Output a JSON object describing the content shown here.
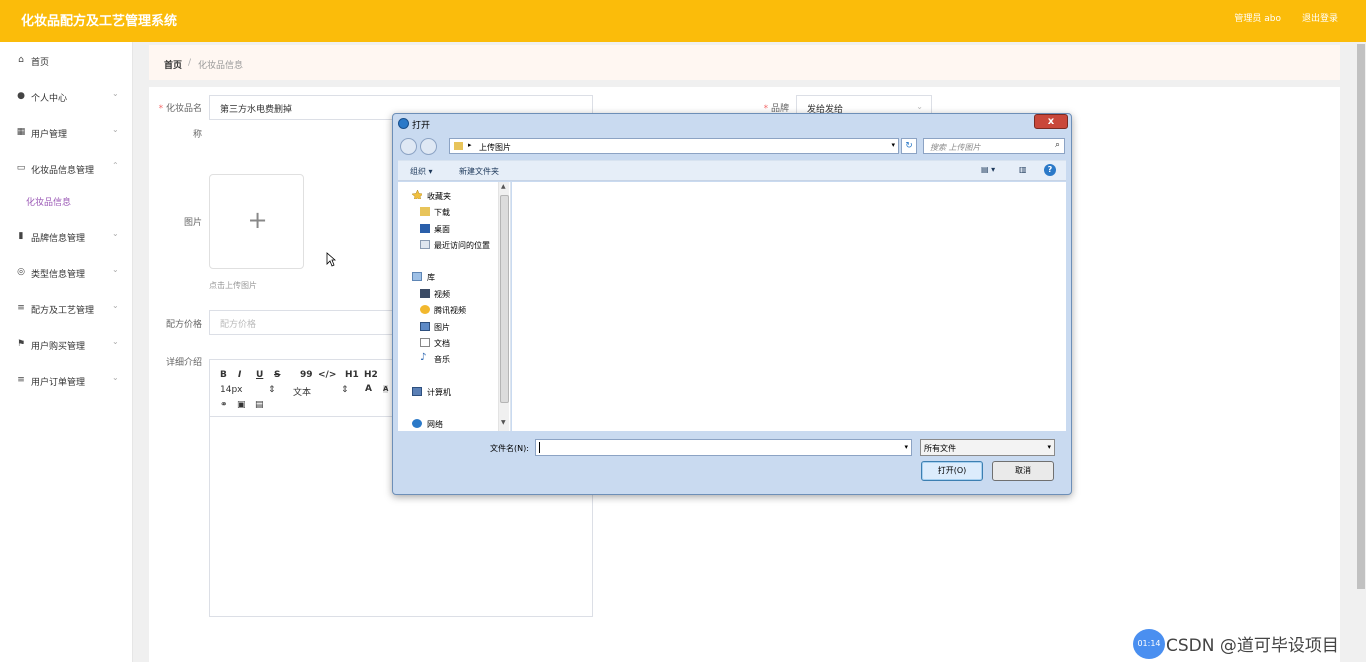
{
  "app": {
    "title": "化妆品配方及工艺管理系统",
    "admin": "管理员 abo",
    "logout": "退出登录"
  },
  "sidebar": {
    "items": [
      {
        "label": "首页",
        "icon": "home-icon",
        "expandable": false
      },
      {
        "label": "个人中心",
        "icon": "user-icon",
        "expandable": true
      },
      {
        "label": "用户管理",
        "icon": "grid-icon",
        "expandable": true
      },
      {
        "label": "化妆品信息管理",
        "icon": "card-icon",
        "expandable": true,
        "expanded": true
      },
      {
        "label": "品牌信息管理",
        "icon": "bar-chart-icon",
        "expandable": true
      },
      {
        "label": "类型信息管理",
        "icon": "target-icon",
        "expandable": true
      },
      {
        "label": "配方及工艺管理",
        "icon": "list-icon",
        "expandable": true
      },
      {
        "label": "用户购买管理",
        "icon": "flag-icon",
        "expandable": true
      },
      {
        "label": "用户订单管理",
        "icon": "list-icon",
        "expandable": true
      }
    ],
    "subitem": "化妆品信息"
  },
  "breadcrumb": {
    "home": "首页",
    "separator": "/",
    "current": "化妆品信息"
  },
  "form": {
    "name_label_1": "化妆品名",
    "name_label_2": "称",
    "name_value": "第三方水电费删掉",
    "brand_label": "品牌",
    "brand_value": "发给发给",
    "image_label": "图片",
    "upload_hint": "点击上传图片",
    "price_label": "配方价格",
    "price_placeholder": "配方价格",
    "detail_label": "详细介绍",
    "editor_toolbar": [
      "B",
      "I",
      "U",
      "S",
      "99",
      "</>",
      "H1",
      "H2"
    ],
    "font_size": "14px",
    "text_type": "文本"
  },
  "dialog": {
    "title": "打开",
    "close": "x",
    "address_path": "上传图片",
    "search_placeholder": "搜索 上传图片",
    "organize": "组织 ▾",
    "new_folder": "新建文件夹",
    "help": "?",
    "favorites_header": "收藏夹",
    "favorites": [
      "下载",
      "桌面",
      "最近访问的位置"
    ],
    "libraries_header": "库",
    "libraries": [
      "视频",
      "腾讯视频",
      "图片",
      "文档",
      "音乐"
    ],
    "computer": "计算机",
    "network": "网络",
    "filename_label": "文件名(N):",
    "filetype": "所有文件",
    "open_button": "打开(O)",
    "cancel_button": "取消"
  },
  "watermark": {
    "badge": "01:14",
    "text": "CSDN @道可毕设项目"
  },
  "colors": {
    "topbar": "#fbbc0a",
    "accent": "#9b59b6",
    "required": "#f56c6c"
  }
}
